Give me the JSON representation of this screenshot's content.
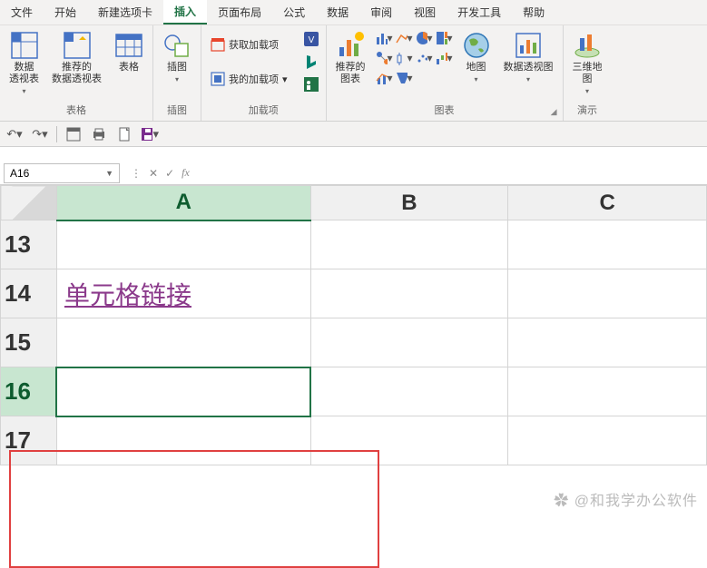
{
  "tabs": [
    "文件",
    "开始",
    "新建选项卡",
    "插入",
    "页面布局",
    "公式",
    "数据",
    "审阅",
    "视图",
    "开发工具",
    "帮助"
  ],
  "active_tab_index": 3,
  "ribbon": {
    "tables": {
      "label": "表格",
      "pivot": "数据\n透视表",
      "rec_pivot": "推荐的\n数据透视表",
      "table": "表格"
    },
    "illus": {
      "label": "插图",
      "btn": "插图"
    },
    "addins": {
      "label": "加载项",
      "get": "获取加载项",
      "my": "我的加载项"
    },
    "charts": {
      "label": "图表",
      "rec": "推荐的\n图表",
      "map": "地图",
      "pivotchart": "数据透视图"
    },
    "tour": {
      "label": "演示",
      "btn": "三维地\n图"
    }
  },
  "namebox": "A16",
  "columns": [
    "A",
    "B",
    "C"
  ],
  "rows": [
    "13",
    "14",
    "15",
    "16",
    "17"
  ],
  "selected_row_index": 3,
  "selected_col_index": 0,
  "cells": {
    "A14": "单元格链接"
  },
  "watermark": "✿ @和我学办公软件"
}
